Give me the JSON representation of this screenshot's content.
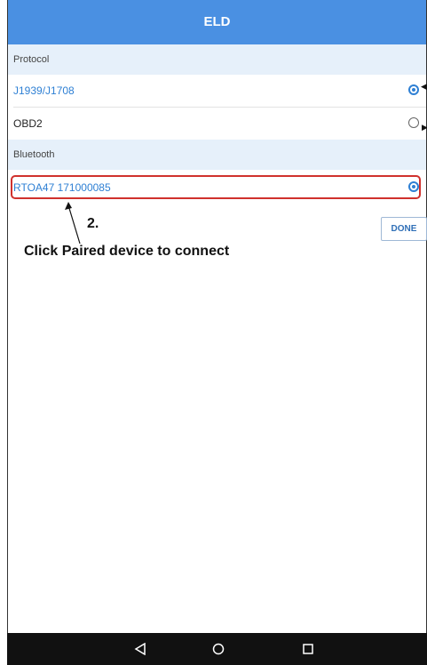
{
  "appbar": {
    "title": "ELD"
  },
  "protocol": {
    "header": "Protocol",
    "options": [
      {
        "label": "J1939/J1708",
        "selected": true
      },
      {
        "label": "OBD2",
        "selected": false
      }
    ]
  },
  "bluetooth": {
    "header": "Bluetooth",
    "devices": [
      {
        "label": "RTOA47 171000085",
        "selected": true
      }
    ]
  },
  "actions": {
    "done_label": "DONE"
  },
  "annotation": {
    "step": "2.",
    "caption": "Click Paired device to connect"
  },
  "navbar": {
    "back_icon": "back-triangle-icon",
    "home_icon": "home-circle-icon",
    "recents_icon": "recents-square-icon"
  },
  "colors": {
    "accent": "#4a90e2",
    "selection_blue": "#2f80d4",
    "annotation_red": "#d0312d"
  }
}
